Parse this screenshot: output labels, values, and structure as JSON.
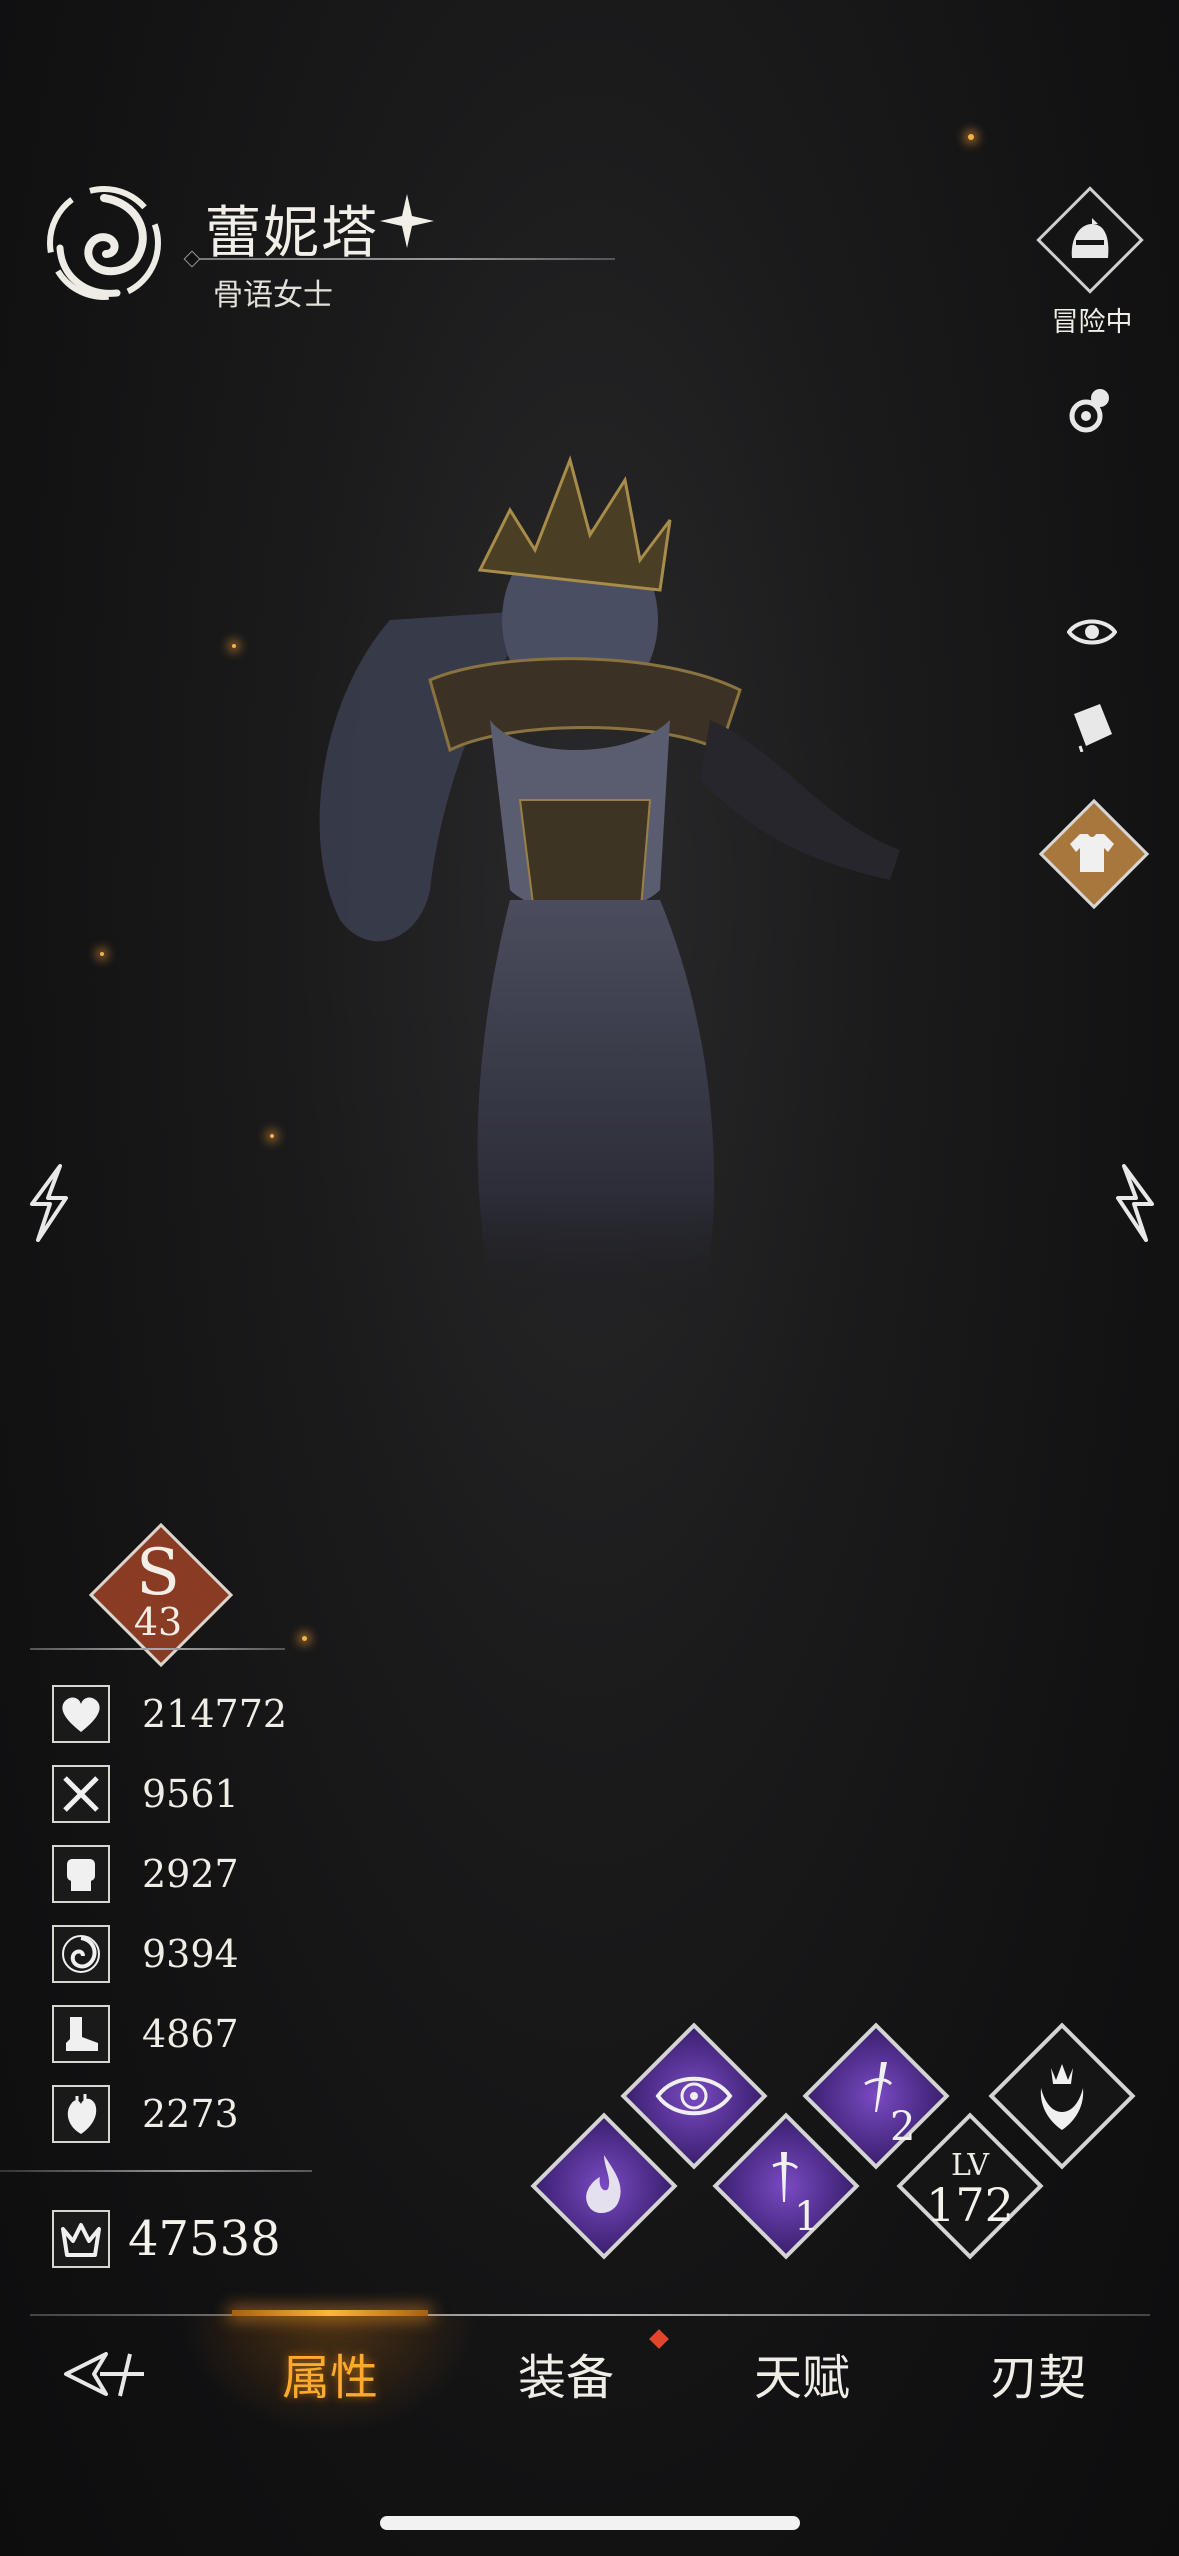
{
  "character": {
    "name": "蕾妮塔",
    "title": "骨语女士"
  },
  "status": {
    "adventure_label": "冒险中"
  },
  "rank": {
    "letter": "S",
    "level": "43"
  },
  "stats": [
    {
      "icon": "heart-icon",
      "value": "214772"
    },
    {
      "icon": "crossed-swords-icon",
      "value": "9561"
    },
    {
      "icon": "fist-icon",
      "value": "2927"
    },
    {
      "icon": "swirl-icon",
      "value": "9394"
    },
    {
      "icon": "boot-icon",
      "value": "4867"
    },
    {
      "icon": "anatomical-heart-icon",
      "value": "2273"
    }
  ],
  "power": {
    "icon": "crown-icon",
    "value": "47538"
  },
  "skills": {
    "lv_label": "LV",
    "lv_value": "172",
    "skill1_badge": "1",
    "skill2_badge": "2"
  },
  "nav": {
    "items": [
      "属性",
      "装备",
      "天赋",
      "刃契"
    ],
    "active_index": 0
  },
  "colors": {
    "accent": "#ffaa2a",
    "skill_purple": "#5b34a0",
    "rank_red": "#8a3b24",
    "notification": "#e2452a"
  }
}
